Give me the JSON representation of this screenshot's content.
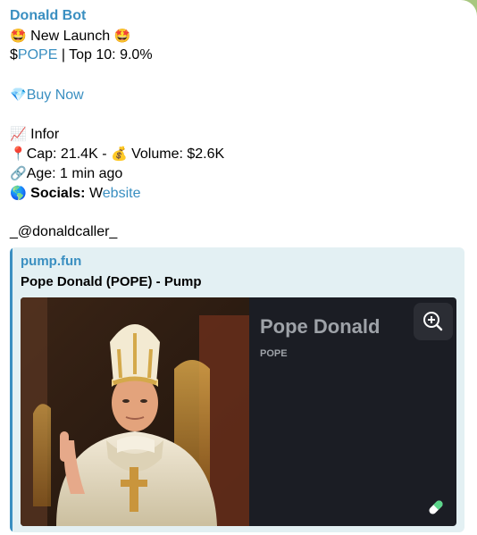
{
  "message": {
    "sender": "Donald Bot",
    "launch_emoji": "🤩",
    "launch_text": "New Launch",
    "ticker_prefix": "$",
    "ticker": "POPE",
    "top10_text": "| Top 10: 9.0%",
    "buy_emoji": "💎",
    "buy_label": "Buy Now",
    "info_emoji": "📈",
    "info_text": "Infor",
    "pin_emoji": "📍",
    "cap_text": "Cap: 21.4K -",
    "bag_emoji": "💰",
    "volume_text": "Volume: $2.6K",
    "link_emoji": "🔗",
    "age_text": "Age: 1 min ago",
    "globe_emoji": "🌎",
    "socials_label": "Socials:",
    "website_first_letter": "W",
    "website_rest": "ebsite",
    "caller": "_@donaldcaller_"
  },
  "link_preview": {
    "site": "pump.fun",
    "title": "Pope Donald (POPE) - Pump",
    "card_name": "Pope Donald",
    "card_ticker": "POPE",
    "zoom_icon": "zoom-in-icon",
    "pill_icon": "pill-icon"
  },
  "colors": {
    "link": "#3a8fc1",
    "preview_bg": "#e3f0f3",
    "card_bg": "#1b1d24",
    "card_text": "#9ea2a8"
  }
}
